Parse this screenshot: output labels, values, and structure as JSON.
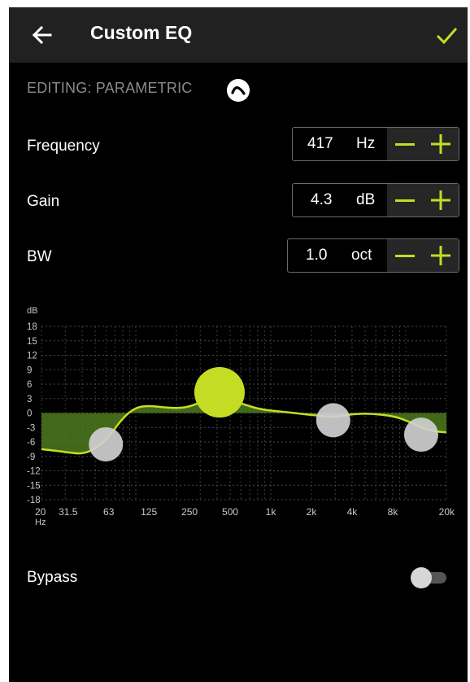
{
  "header": {
    "title": "Custom EQ",
    "back_icon": "arrow-left-icon",
    "confirm_icon": "check-icon",
    "accent": "#c4dd24"
  },
  "editing": {
    "label": "EDITING: PARAMETRIC",
    "toggle_icon": "collapse-chevron-icon"
  },
  "params": [
    {
      "label": "Frequency",
      "value": "417",
      "unit": "Hz"
    },
    {
      "label": "Gain",
      "value": "4.3",
      "unit": "dB"
    },
    {
      "label": "BW",
      "value": "1.0",
      "unit": "oct"
    }
  ],
  "chart_data": {
    "type": "line",
    "ylabel": "dB",
    "xlabel": "Hz",
    "ylim": [
      -18,
      18
    ],
    "y_ticks": [
      "18",
      "15",
      "12",
      "9",
      "6",
      "3",
      "0",
      "-3",
      "-6",
      "-9",
      "-12",
      "-15",
      "-18"
    ],
    "x_ticks": [
      "20",
      "31.5",
      "63",
      "125",
      "250",
      "500",
      "1k",
      "2k",
      "4k",
      "8k",
      "20k"
    ],
    "bands": [
      {
        "freq_hz": 60,
        "gain_db": -6.5,
        "active": false
      },
      {
        "freq_hz": 417,
        "gain_db": 4.3,
        "active": true
      },
      {
        "freq_hz": 2900,
        "gain_db": -1.5,
        "active": false
      },
      {
        "freq_hz": 13000,
        "gain_db": -4.5,
        "active": false
      }
    ],
    "curve": [
      [
        20,
        -7.5
      ],
      [
        25,
        -7.8
      ],
      [
        31.5,
        -8.2
      ],
      [
        40,
        -8.5
      ],
      [
        50,
        -7.5
      ],
      [
        63,
        -5
      ],
      [
        80,
        -1
      ],
      [
        100,
        1.2
      ],
      [
        125,
        1.5
      ],
      [
        160,
        1.2
      ],
      [
        200,
        1.0
      ],
      [
        250,
        1.3
      ],
      [
        315,
        2.5
      ],
      [
        417,
        3.3
      ],
      [
        500,
        2.8
      ],
      [
        630,
        1.8
      ],
      [
        800,
        0.9
      ],
      [
        1000,
        0.5
      ],
      [
        1500,
        0
      ],
      [
        2000,
        -0.4
      ],
      [
        2900,
        -0.9
      ],
      [
        4000,
        -0.2
      ],
      [
        5500,
        -0.1
      ],
      [
        8000,
        -0.6
      ],
      [
        10000,
        -1.5
      ],
      [
        13000,
        -3
      ],
      [
        16000,
        -3.8
      ],
      [
        20000,
        -4
      ]
    ],
    "grid": true
  },
  "bypass": {
    "label": "Bypass",
    "on": false
  }
}
